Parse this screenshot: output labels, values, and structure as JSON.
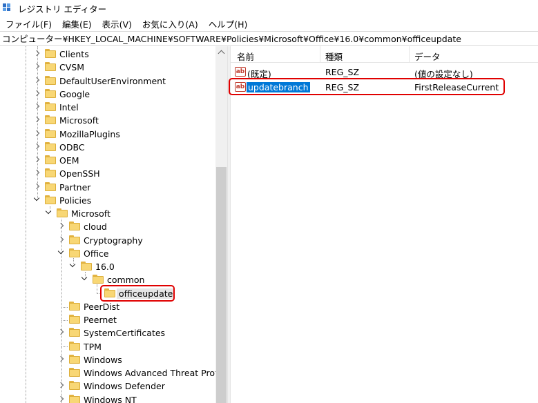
{
  "window": {
    "title": "レジストリ エディター"
  },
  "menu": [
    "ファイル(F)",
    "編集(E)",
    "表示(V)",
    "お気に入り(A)",
    "ヘルプ(H)"
  ],
  "address": "コンピューター¥HKEY_LOCAL_MACHINE¥SOFTWARE¥Policies¥Microsoft¥Office¥16.0¥common¥officeupdate",
  "tree": {
    "software_children": [
      "Clients",
      "CVSM",
      "DefaultUserEnvironment",
      "Google",
      "Intel",
      "Microsoft",
      "MozillaPlugins",
      "ODBC",
      "OEM",
      "OpenSSH",
      "Partner",
      "Policies"
    ],
    "policies_children": [
      "Microsoft"
    ],
    "policies_microsoft_children": [
      "cloud",
      "Cryptography",
      "Office",
      "PeerDist",
      "Peernet",
      "SystemCertificates",
      "TPM",
      "Windows",
      "Windows Advanced Threat Protection",
      "Windows Defender",
      "Windows NT"
    ],
    "office_children": [
      "16.0"
    ],
    "v16_children": [
      "common"
    ],
    "common_children": [
      "officeupdate"
    ],
    "selected": "officeupdate"
  },
  "list": {
    "columns": [
      "名前",
      "種類",
      "データ"
    ],
    "rows": [
      {
        "icon": "ab",
        "name": "(既定)",
        "type": "REG_SZ",
        "data": "(値の設定なし)"
      },
      {
        "icon": "ab",
        "name": "updatebranch",
        "type": "REG_SZ",
        "data": "FirstReleaseCurrent"
      }
    ]
  },
  "colors": {
    "highlight": "#e00000",
    "selection": "#0078d7",
    "folder": "#f8d775"
  }
}
